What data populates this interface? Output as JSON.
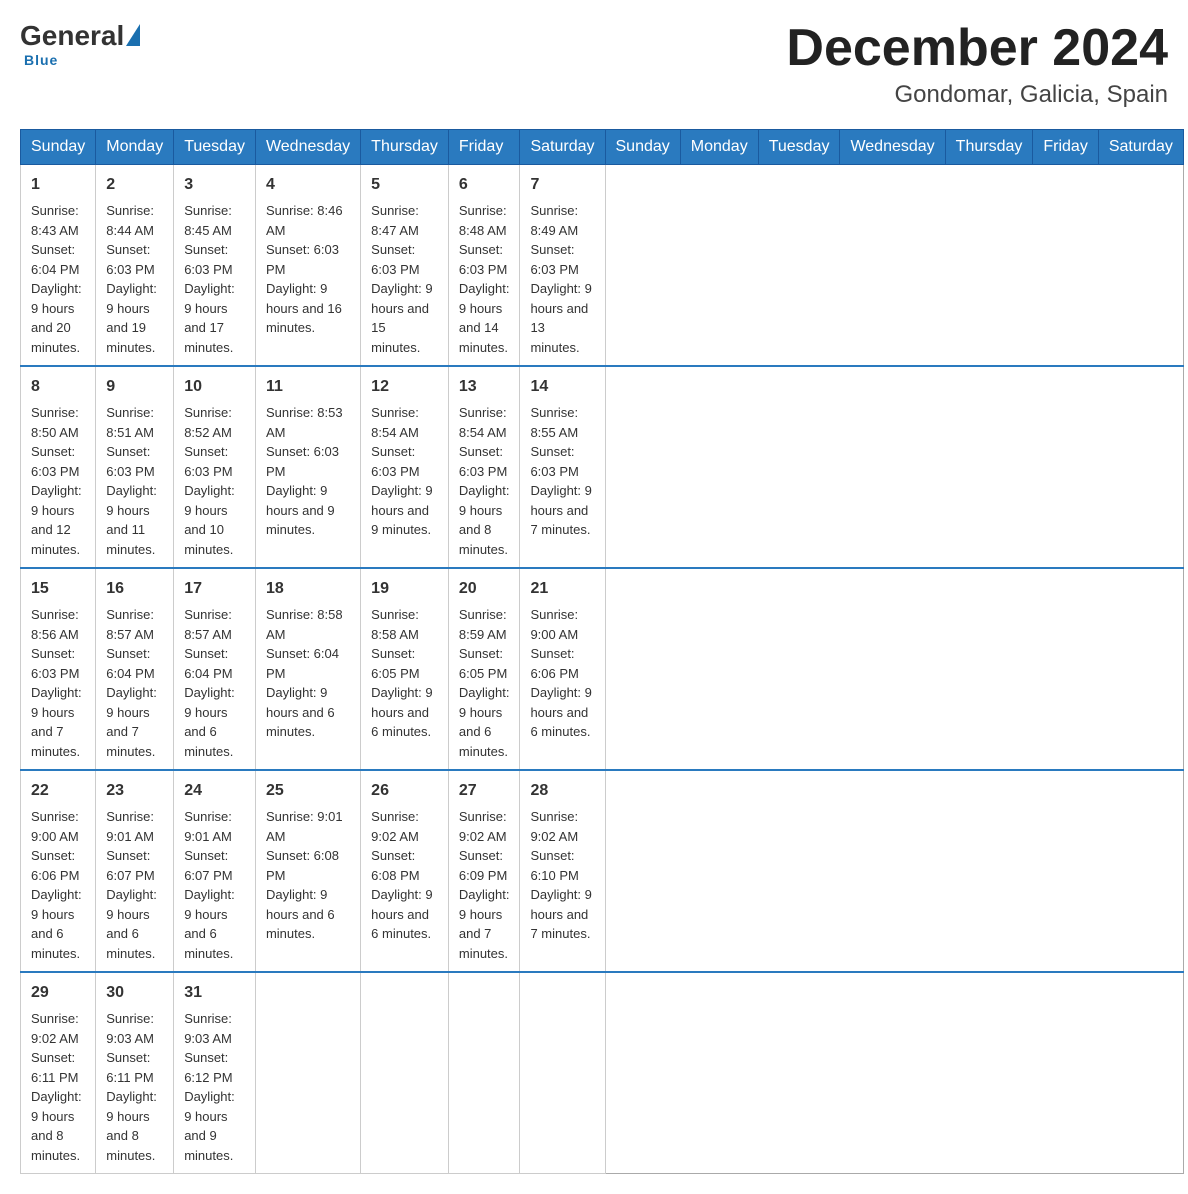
{
  "header": {
    "logo_general": "General",
    "logo_blue": "Blue",
    "month_title": "December 2024",
    "location": "Gondomar, Galicia, Spain"
  },
  "days_of_week": [
    "Sunday",
    "Monday",
    "Tuesday",
    "Wednesday",
    "Thursday",
    "Friday",
    "Saturday"
  ],
  "weeks": [
    [
      {
        "day": "1",
        "sunrise": "Sunrise: 8:43 AM",
        "sunset": "Sunset: 6:04 PM",
        "daylight": "Daylight: 9 hours and 20 minutes."
      },
      {
        "day": "2",
        "sunrise": "Sunrise: 8:44 AM",
        "sunset": "Sunset: 6:03 PM",
        "daylight": "Daylight: 9 hours and 19 minutes."
      },
      {
        "day": "3",
        "sunrise": "Sunrise: 8:45 AM",
        "sunset": "Sunset: 6:03 PM",
        "daylight": "Daylight: 9 hours and 17 minutes."
      },
      {
        "day": "4",
        "sunrise": "Sunrise: 8:46 AM",
        "sunset": "Sunset: 6:03 PM",
        "daylight": "Daylight: 9 hours and 16 minutes."
      },
      {
        "day": "5",
        "sunrise": "Sunrise: 8:47 AM",
        "sunset": "Sunset: 6:03 PM",
        "daylight": "Daylight: 9 hours and 15 minutes."
      },
      {
        "day": "6",
        "sunrise": "Sunrise: 8:48 AM",
        "sunset": "Sunset: 6:03 PM",
        "daylight": "Daylight: 9 hours and 14 minutes."
      },
      {
        "day": "7",
        "sunrise": "Sunrise: 8:49 AM",
        "sunset": "Sunset: 6:03 PM",
        "daylight": "Daylight: 9 hours and 13 minutes."
      }
    ],
    [
      {
        "day": "8",
        "sunrise": "Sunrise: 8:50 AM",
        "sunset": "Sunset: 6:03 PM",
        "daylight": "Daylight: 9 hours and 12 minutes."
      },
      {
        "day": "9",
        "sunrise": "Sunrise: 8:51 AM",
        "sunset": "Sunset: 6:03 PM",
        "daylight": "Daylight: 9 hours and 11 minutes."
      },
      {
        "day": "10",
        "sunrise": "Sunrise: 8:52 AM",
        "sunset": "Sunset: 6:03 PM",
        "daylight": "Daylight: 9 hours and 10 minutes."
      },
      {
        "day": "11",
        "sunrise": "Sunrise: 8:53 AM",
        "sunset": "Sunset: 6:03 PM",
        "daylight": "Daylight: 9 hours and 9 minutes."
      },
      {
        "day": "12",
        "sunrise": "Sunrise: 8:54 AM",
        "sunset": "Sunset: 6:03 PM",
        "daylight": "Daylight: 9 hours and 9 minutes."
      },
      {
        "day": "13",
        "sunrise": "Sunrise: 8:54 AM",
        "sunset": "Sunset: 6:03 PM",
        "daylight": "Daylight: 9 hours and 8 minutes."
      },
      {
        "day": "14",
        "sunrise": "Sunrise: 8:55 AM",
        "sunset": "Sunset: 6:03 PM",
        "daylight": "Daylight: 9 hours and 7 minutes."
      }
    ],
    [
      {
        "day": "15",
        "sunrise": "Sunrise: 8:56 AM",
        "sunset": "Sunset: 6:03 PM",
        "daylight": "Daylight: 9 hours and 7 minutes."
      },
      {
        "day": "16",
        "sunrise": "Sunrise: 8:57 AM",
        "sunset": "Sunset: 6:04 PM",
        "daylight": "Daylight: 9 hours and 7 minutes."
      },
      {
        "day": "17",
        "sunrise": "Sunrise: 8:57 AM",
        "sunset": "Sunset: 6:04 PM",
        "daylight": "Daylight: 9 hours and 6 minutes."
      },
      {
        "day": "18",
        "sunrise": "Sunrise: 8:58 AM",
        "sunset": "Sunset: 6:04 PM",
        "daylight": "Daylight: 9 hours and 6 minutes."
      },
      {
        "day": "19",
        "sunrise": "Sunrise: 8:58 AM",
        "sunset": "Sunset: 6:05 PM",
        "daylight": "Daylight: 9 hours and 6 minutes."
      },
      {
        "day": "20",
        "sunrise": "Sunrise: 8:59 AM",
        "sunset": "Sunset: 6:05 PM",
        "daylight": "Daylight: 9 hours and 6 minutes."
      },
      {
        "day": "21",
        "sunrise": "Sunrise: 9:00 AM",
        "sunset": "Sunset: 6:06 PM",
        "daylight": "Daylight: 9 hours and 6 minutes."
      }
    ],
    [
      {
        "day": "22",
        "sunrise": "Sunrise: 9:00 AM",
        "sunset": "Sunset: 6:06 PM",
        "daylight": "Daylight: 9 hours and 6 minutes."
      },
      {
        "day": "23",
        "sunrise": "Sunrise: 9:01 AM",
        "sunset": "Sunset: 6:07 PM",
        "daylight": "Daylight: 9 hours and 6 minutes."
      },
      {
        "day": "24",
        "sunrise": "Sunrise: 9:01 AM",
        "sunset": "Sunset: 6:07 PM",
        "daylight": "Daylight: 9 hours and 6 minutes."
      },
      {
        "day": "25",
        "sunrise": "Sunrise: 9:01 AM",
        "sunset": "Sunset: 6:08 PM",
        "daylight": "Daylight: 9 hours and 6 minutes."
      },
      {
        "day": "26",
        "sunrise": "Sunrise: 9:02 AM",
        "sunset": "Sunset: 6:08 PM",
        "daylight": "Daylight: 9 hours and 6 minutes."
      },
      {
        "day": "27",
        "sunrise": "Sunrise: 9:02 AM",
        "sunset": "Sunset: 6:09 PM",
        "daylight": "Daylight: 9 hours and 7 minutes."
      },
      {
        "day": "28",
        "sunrise": "Sunrise: 9:02 AM",
        "sunset": "Sunset: 6:10 PM",
        "daylight": "Daylight: 9 hours and 7 minutes."
      }
    ],
    [
      {
        "day": "29",
        "sunrise": "Sunrise: 9:02 AM",
        "sunset": "Sunset: 6:11 PM",
        "daylight": "Daylight: 9 hours and 8 minutes."
      },
      {
        "day": "30",
        "sunrise": "Sunrise: 9:03 AM",
        "sunset": "Sunset: 6:11 PM",
        "daylight": "Daylight: 9 hours and 8 minutes."
      },
      {
        "day": "31",
        "sunrise": "Sunrise: 9:03 AM",
        "sunset": "Sunset: 6:12 PM",
        "daylight": "Daylight: 9 hours and 9 minutes."
      },
      null,
      null,
      null,
      null
    ]
  ]
}
